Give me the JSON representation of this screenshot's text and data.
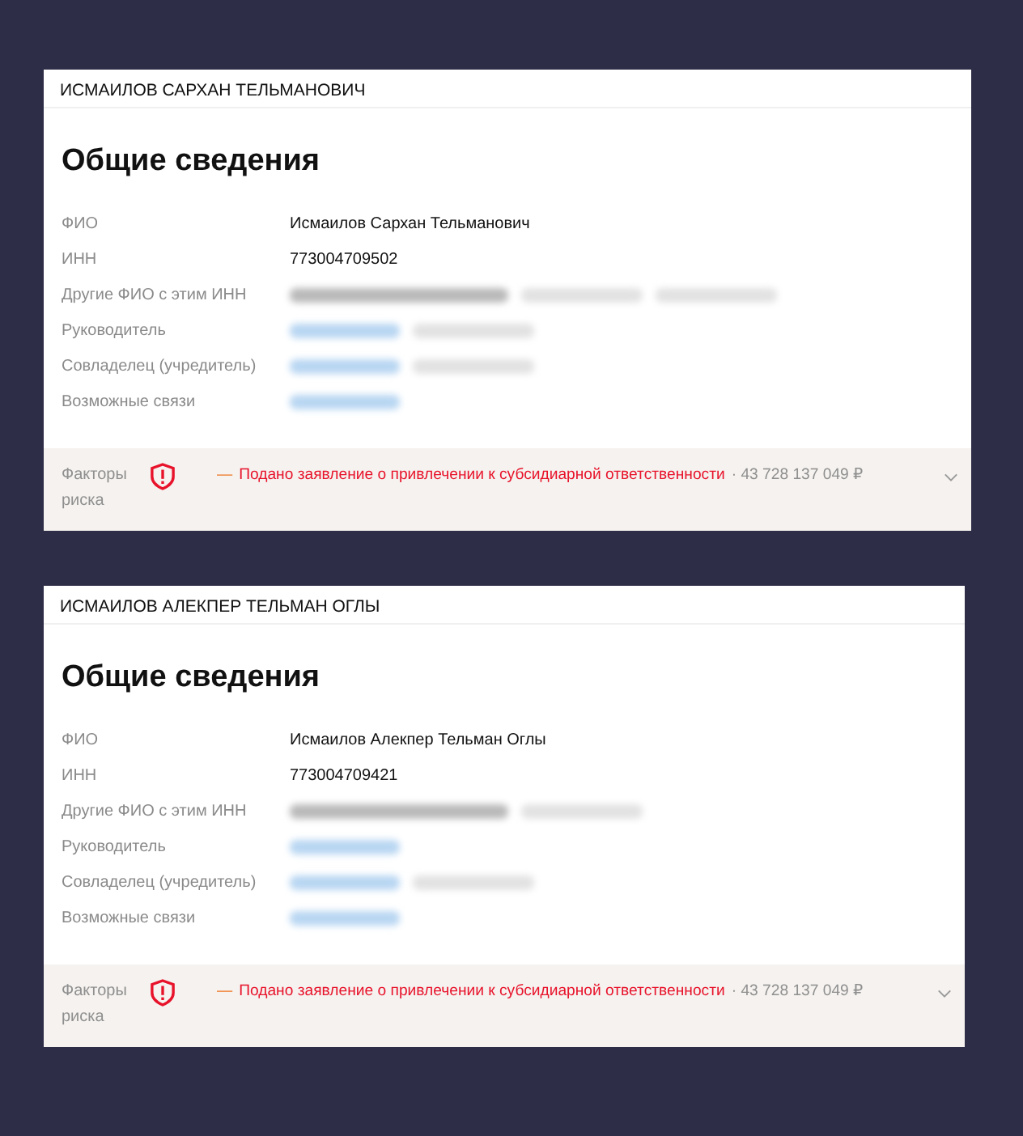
{
  "cards": [
    {
      "header": "ИСМАИЛОВ САРХАН ТЕЛЬМАНОВИЧ",
      "title": "Общие сведения",
      "fields": [
        {
          "label": "ФИО",
          "value": "Исмаилов Сархан Тельманович"
        },
        {
          "label": "ИНН",
          "value": "773004709502"
        },
        {
          "label": "Другие ФИО с этим ИНН",
          "redacted": [
            {
              "kind": "name"
            },
            {
              "kind": "text"
            },
            {
              "kind": "text"
            }
          ]
        },
        {
          "label": "Руководитель",
          "redacted": [
            {
              "kind": "link"
            },
            {
              "kind": "text"
            }
          ]
        },
        {
          "label": "Совладелец (учредитель)",
          "redacted": [
            {
              "kind": "link"
            },
            {
              "kind": "text"
            }
          ]
        },
        {
          "label": "Возможные связи",
          "redacted": [
            {
              "kind": "link"
            }
          ]
        }
      ],
      "risk": {
        "label": "Факторы риска",
        "marker": "—",
        "text": "Подано заявление о привлечении к субсидиарной ответственности",
        "amount": "· 43 728 137 049 ₽",
        "expanded": false
      }
    },
    {
      "header": "ИСМАИЛОВ АЛЕКПЕР ТЕЛЬМАН ОГЛЫ",
      "title": "Общие сведения",
      "fields": [
        {
          "label": "ФИО",
          "value": "Исмаилов Алекпер Тельман Оглы"
        },
        {
          "label": "ИНН",
          "value": "773004709421"
        },
        {
          "label": "Другие ФИО с этим ИНН",
          "redacted": [
            {
              "kind": "name"
            },
            {
              "kind": "text"
            }
          ]
        },
        {
          "label": "Руководитель",
          "redacted": [
            {
              "kind": "link"
            }
          ]
        },
        {
          "label": "Совладелец (учредитель)",
          "redacted": [
            {
              "kind": "link"
            },
            {
              "kind": "text"
            }
          ]
        },
        {
          "label": "Возможные связи",
          "redacted": [
            {
              "kind": "link"
            }
          ]
        }
      ],
      "risk": {
        "label": "Факторы риска",
        "marker": "—",
        "text": "Подано заявление о привлечении к субсидиарной ответственности",
        "amount": "· 43 728 137 049 ₽",
        "expanded": false
      }
    }
  ]
}
